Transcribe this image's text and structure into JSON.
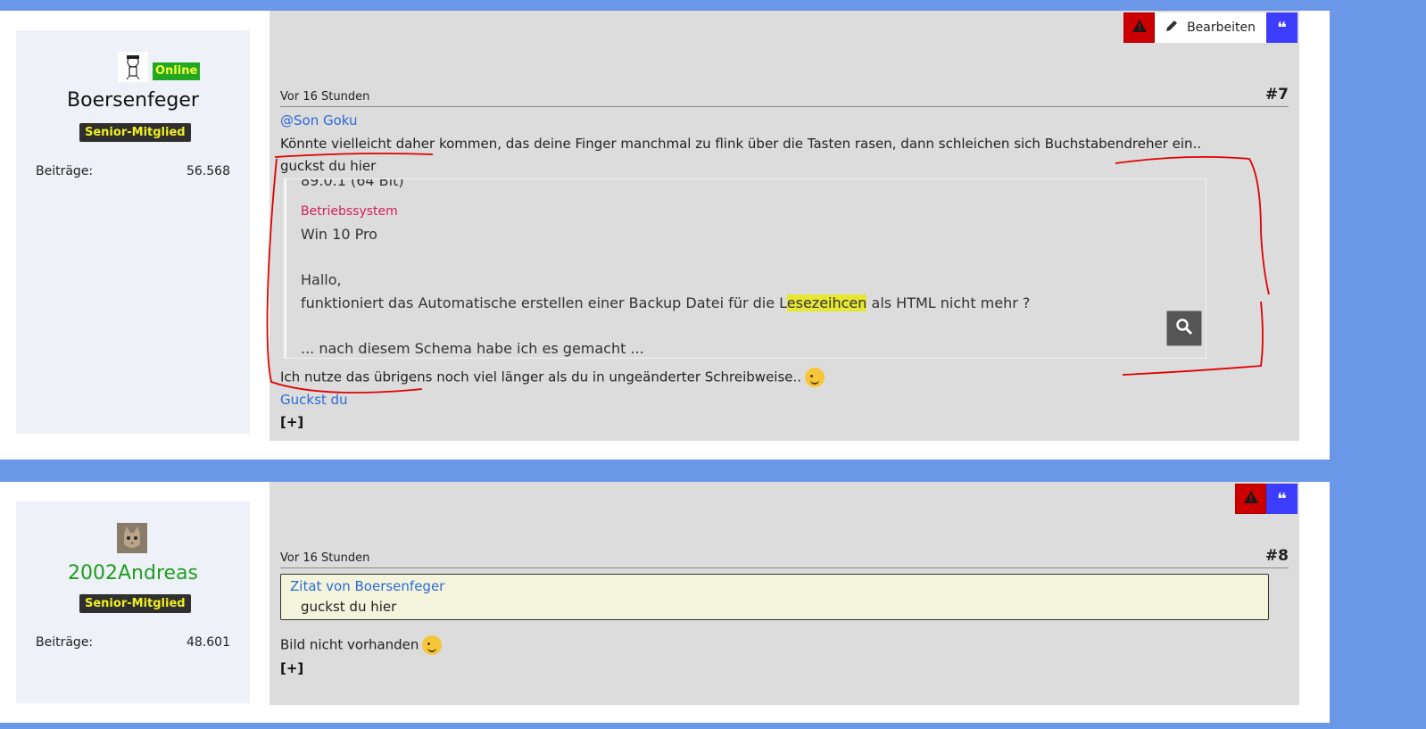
{
  "post1": {
    "user": {
      "status": "Online",
      "name": "Boersenfeger",
      "rank": "Senior-Mitglied",
      "posts_label": "Beiträge:",
      "posts_count": "56.568"
    },
    "actions": {
      "report_icon": "warning-icon",
      "edit_label": "Bearbeiten",
      "quote_icon": "quote-icon"
    },
    "time": "Vor 16 Stunden",
    "number": "#7",
    "mention": "@Son Goku",
    "line1": "Könnte vielleicht daher kommen, das deine Finger manchmal zu flink über die Tasten rasen, dann schleichen sich Buchstabendreher ein..",
    "line2": "guckst du hier",
    "embed": {
      "cut_top": "89.0.1 (64 Bit)",
      "os_label": "Betriebssystem",
      "os_value": "Win 10 Pro",
      "hello": "Hallo,",
      "text_before": "funktioniert das Automatische erstellen einer Backup Datei für die L",
      "text_highlight": "esezeihcen",
      "text_after": " als HTML nicht mehr ?",
      "cut_bottom": "... nach diesem Schema habe ich es gemacht ..."
    },
    "line3": "Ich nutze das übrigens noch viel länger als du in ungeänderter Schreibweise..",
    "link": "Guckst du",
    "expand": "[+]"
  },
  "post2": {
    "user": {
      "name": "2002Andreas",
      "rank": "Senior-Mitglied",
      "posts_label": "Beiträge:",
      "posts_count": "48.601"
    },
    "actions": {
      "report_icon": "warning-icon",
      "quote_icon": "quote-icon"
    },
    "time": "Vor 16 Stunden",
    "number": "#8",
    "quote": {
      "author": "Zitat von Boersenfeger",
      "text": "guckst du hier"
    },
    "text": "Bild nicht vorhanden",
    "expand": "[+]"
  },
  "colors": {
    "background": "#6b97e8",
    "online": "#22a722",
    "rank_bg": "#2f2f2f",
    "rank_text": "#f0f020",
    "report": "#cc0000",
    "quote_btn": "#3d3dff",
    "link": "#2a6bd6",
    "annotation": "#e00000"
  }
}
